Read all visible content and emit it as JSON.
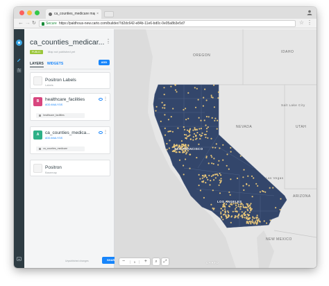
{
  "browser": {
    "tab_title": "ca_counties_medicare map | C",
    "tab_close": "×",
    "secure_label": "Secure",
    "url": "https://paldhous-new.carto.com/builder/7d2dc642-e84b-11e6-bd0c-0e05a8b3e5d7"
  },
  "editor": {
    "map_title": "ca_counties_medicar...",
    "privacy_badge": "PUBLIC",
    "publish_note": "Map not published yet",
    "tabs": [
      {
        "label": "LAYERS",
        "active": true
      },
      {
        "label": "WIDGETS",
        "active": false
      }
    ],
    "add_button": "ADD",
    "layers": [
      {
        "name": "Positron Labels",
        "subtitle": "Labels",
        "thumb": "light"
      },
      {
        "name": "healthcare_facilities",
        "subtitle": "ADD ANALYSIS",
        "source": "healthcare_facilities",
        "thumb_text": "B",
        "thumb": "pink"
      },
      {
        "name": "ca_counties_medica...",
        "subtitle": "ADD ANALYSIS",
        "source": "ca_counties_medicare",
        "thumb_text": "A",
        "thumb": "green"
      },
      {
        "name": "Positron",
        "subtitle": "Basemap",
        "thumb": "light"
      }
    ],
    "footer_note": "Unpublished changes",
    "share_button": "SHARE"
  },
  "map": {
    "region_labels": [
      "OREGON",
      "IDAHO",
      "NEVADA",
      "UTAH",
      "ARIZONA",
      "NEW MEXICO",
      "Salt Lake City",
      "Las Vegas"
    ],
    "city_labels": [
      "SAN FRANCISCO",
      "LOS ANGELES"
    ],
    "zoom_level": "5",
    "zoom_in": "+",
    "zoom_out": "−",
    "attribution": "CARTO",
    "colors": {
      "county_fill": "#33466b",
      "facility_point": "#f2cd7a",
      "land": "#e6e6e6",
      "water": "#dcdcdc"
    }
  }
}
